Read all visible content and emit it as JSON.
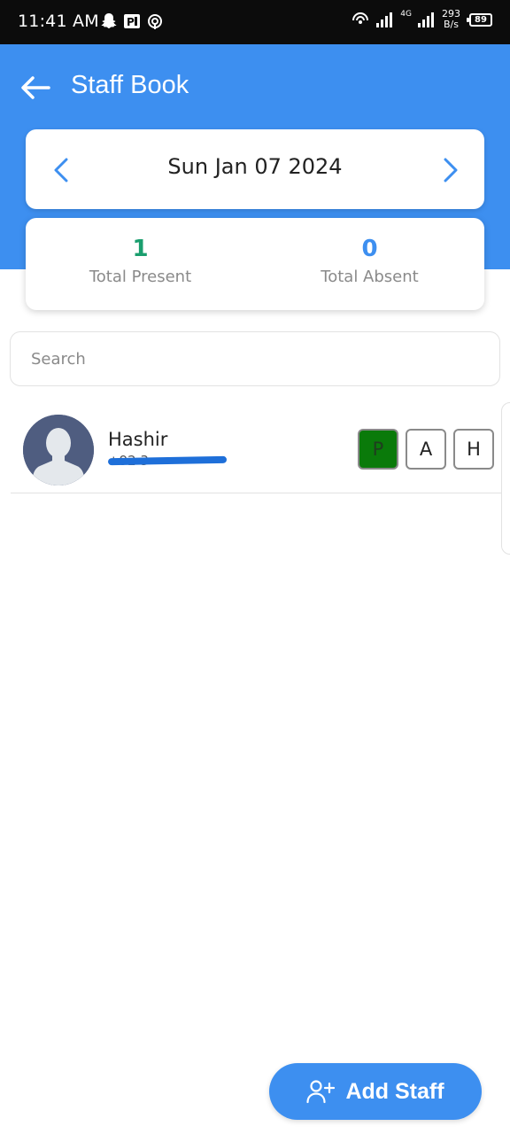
{
  "status_bar": {
    "time": "11:41 AM",
    "network_speed_value": "293",
    "network_speed_unit": "B/s",
    "network_type": "4G",
    "battery": "89"
  },
  "header": {
    "title": "Staff Book",
    "background_color": "#3d8ff0"
  },
  "date_picker": {
    "date": "Sun Jan 07 2024"
  },
  "summary": {
    "present_count": "1",
    "present_label": "Total Present",
    "absent_count": "0",
    "absent_label": "Total Absent",
    "present_color": "#1a9e6e",
    "absent_color": "#3d8ff0"
  },
  "search": {
    "placeholder": "Search"
  },
  "staff": [
    {
      "name": "Hashir",
      "phone": "+92 3",
      "attendance_buttons": [
        "P",
        "A",
        "H"
      ],
      "selected": "P"
    }
  ],
  "fab": {
    "label": "Add Staff",
    "icon": "add-user-icon"
  }
}
